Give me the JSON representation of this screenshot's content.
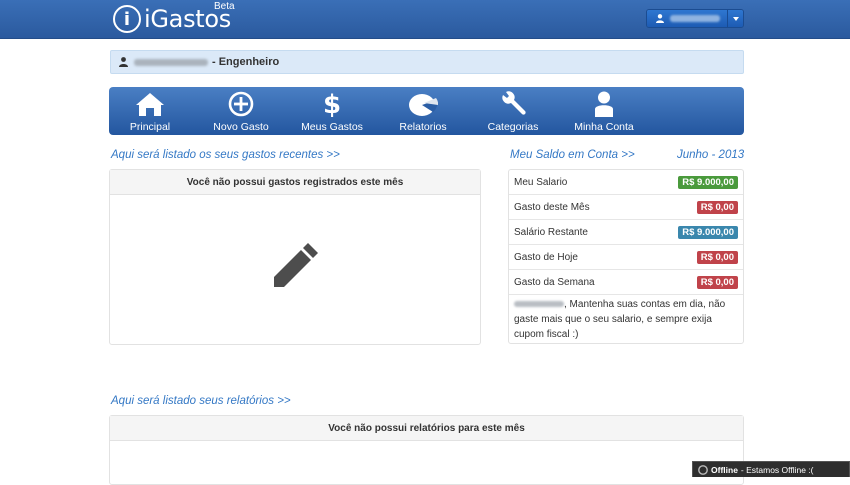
{
  "header": {
    "logo_text": "iGastos",
    "logo_beta": "Beta",
    "user_button_caret": "caret-down-icon"
  },
  "infobar": {
    "role_text": "- Engenheiro"
  },
  "nav": {
    "items": [
      {
        "label": "Principal",
        "icon": "home-icon"
      },
      {
        "label": "Novo Gasto",
        "icon": "plus-circle-icon"
      },
      {
        "label": "Meus Gastos",
        "icon": "dollar-icon"
      },
      {
        "label": "Relatorios",
        "icon": "pie-chart-icon"
      },
      {
        "label": "Categorias",
        "icon": "wrench-icon"
      },
      {
        "label": "Minha Conta",
        "icon": "user-icon"
      }
    ]
  },
  "recent": {
    "heading": "Aqui será listado os seus gastos recentes >>",
    "empty_message": "Você não possui gastos registrados este mês",
    "icon": "pencil-icon"
  },
  "balance": {
    "heading": "Meu Saldo em Conta >>",
    "month": "Junho - 2013",
    "rows": [
      {
        "label": "Meu Salario",
        "value": "R$ 9.000,00",
        "color": "#4a9a3c"
      },
      {
        "label": "Gasto deste Mês",
        "value": "R$ 0,00",
        "color": "#c0434a"
      },
      {
        "label": "Salário Restante",
        "value": "R$ 9.000,00",
        "color": "#3a87ad"
      },
      {
        "label": "Gasto de Hoje",
        "value": "R$ 0,00",
        "color": "#c0434a"
      },
      {
        "label": "Gasto da Semana",
        "value": "R$ 0,00",
        "color": "#c0434a"
      }
    ],
    "note": ", Mantenha suas contas em dia, não gaste mais que o seu salario, e sempre exija cupom fiscal :)"
  },
  "reports": {
    "heading": "Aqui será listado seus relatórios >>",
    "empty_message": "Você não possui relatórios para este mês"
  },
  "offline": {
    "title": "Offline",
    "message": "- Estamos Offline :("
  }
}
